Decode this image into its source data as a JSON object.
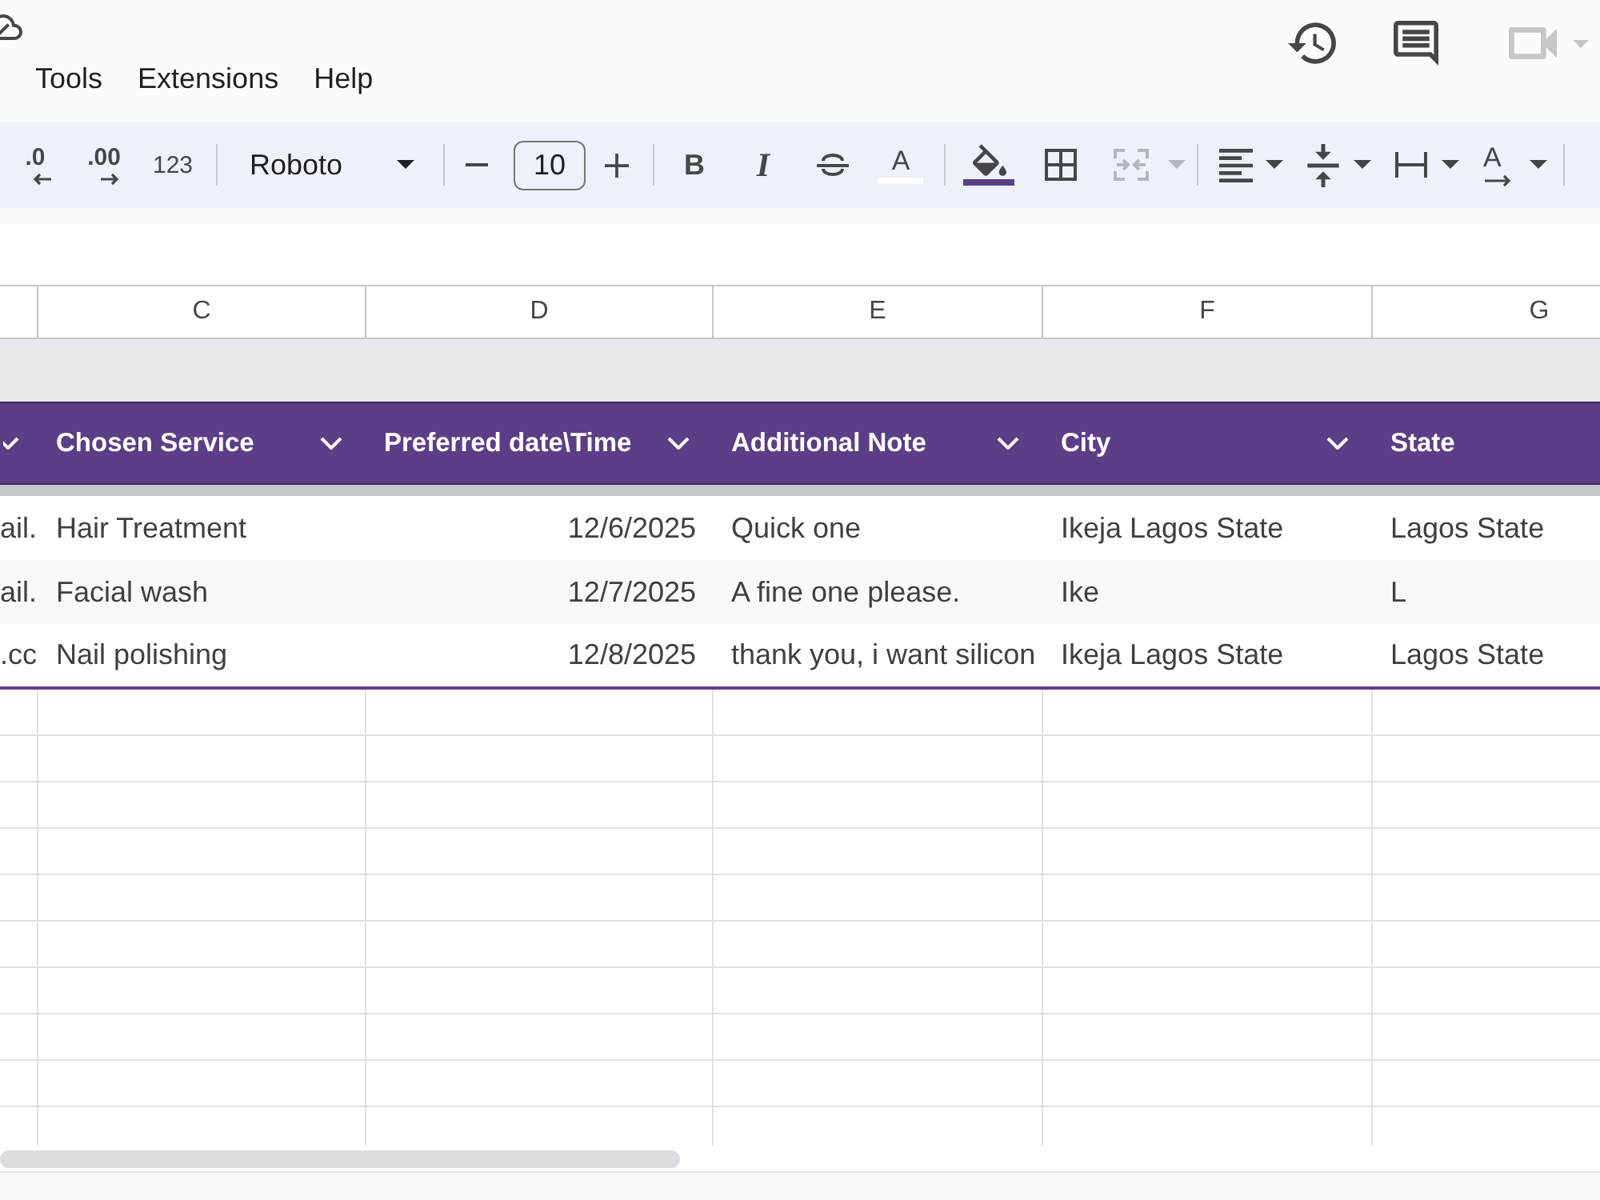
{
  "header": {
    "menu": [
      {
        "label": "Tools"
      },
      {
        "label": "Extensions"
      },
      {
        "label": "Help"
      }
    ],
    "actions": [
      {
        "kind": "history",
        "disabled": false
      },
      {
        "kind": "comments",
        "disabled": false
      },
      {
        "kind": "meet",
        "disabled": true
      }
    ]
  },
  "toolbar": {
    "groups": [
      [
        {
          "kind": "decimal_decrease",
          "label": ".0",
          "disabled": false
        },
        {
          "kind": "decimal_increase",
          "label": ".00",
          "disabled": false
        },
        {
          "kind": "number_format",
          "label": "123",
          "disabled": false
        }
      ],
      [
        {
          "kind": "font",
          "label": "Roboto",
          "disabled": false
        }
      ],
      [
        {
          "kind": "size_down",
          "disabled": false
        },
        {
          "kind": "size_field",
          "value": "10",
          "disabled": false
        },
        {
          "kind": "size_up",
          "disabled": false
        }
      ],
      [
        {
          "kind": "bold",
          "label": "B",
          "disabled": false
        },
        {
          "kind": "italic",
          "label": "I",
          "disabled": false
        },
        {
          "kind": "strikethrough",
          "disabled": false
        },
        {
          "kind": "text_color",
          "label": "A",
          "color": "#ffffff",
          "disabled": false
        }
      ],
      [
        {
          "kind": "fill_color",
          "color": "#5c3e87",
          "disabled": false
        },
        {
          "kind": "borders",
          "disabled": false
        },
        {
          "kind": "merge",
          "disabled": true
        }
      ],
      [
        {
          "kind": "align",
          "disabled": false
        },
        {
          "kind": "valign",
          "disabled": false
        },
        {
          "kind": "wrap",
          "disabled": false
        },
        {
          "kind": "rotate",
          "label": "A",
          "disabled": false
        }
      ]
    ]
  },
  "sheet": {
    "column_letters": [
      "C",
      "D",
      "E",
      "F",
      "G"
    ],
    "table": {
      "columns": [
        {
          "filter": true,
          "kind": "text"
        },
        {
          "label": "Chosen Service",
          "filter": true,
          "kind": "text"
        },
        {
          "label": "Preferred date\\Time",
          "filter": true,
          "kind": "date"
        },
        {
          "label": "Additional Note",
          "filter": true,
          "kind": "text"
        },
        {
          "label": "City",
          "filter": true,
          "kind": "text"
        },
        {
          "label": "State",
          "filter": false,
          "kind": "text"
        }
      ],
      "rows": [
        [
          "ail.",
          "Hair Treatment",
          "12/6/2025",
          "Quick one",
          "Ikeja Lagos State",
          "Lagos State"
        ],
        [
          "ail.",
          "Facial wash",
          "12/7/2025",
          "A fine one please.",
          "Ike",
          "L"
        ],
        [
          ".cc",
          "Nail polishing",
          "12/8/2025",
          "thank you, i want silicon",
          "Ikeja Lagos State",
          "Lagos State"
        ]
      ]
    }
  }
}
